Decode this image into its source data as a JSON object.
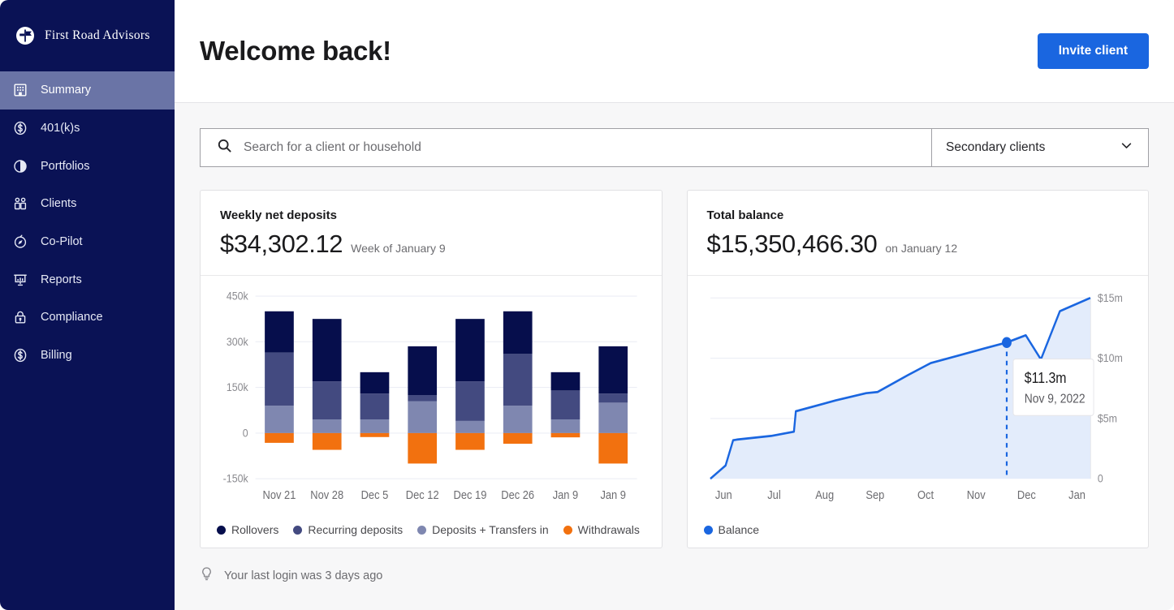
{
  "brand": {
    "name": "First Road Advisors",
    "logo_icon": "road-marker-circle-icon",
    "sidebar_bg": "#0a1255",
    "active_bg": "#6a74a6"
  },
  "sidebar": {
    "items": [
      {
        "label": "Summary",
        "icon": "building-icon",
        "active": true
      },
      {
        "label": "401(k)s",
        "icon": "dollar-circle-icon",
        "active": false
      },
      {
        "label": "Portfolios",
        "icon": "pie-chart-icon",
        "active": false
      },
      {
        "label": "Clients",
        "icon": "people-icon",
        "active": false
      },
      {
        "label": "Co-Pilot",
        "icon": "compass-icon",
        "active": false
      },
      {
        "label": "Reports",
        "icon": "presentation-chart-icon",
        "active": false
      },
      {
        "label": "Compliance",
        "icon": "lock-icon",
        "active": false
      },
      {
        "label": "Billing",
        "icon": "dollar-circle-icon",
        "active": false
      }
    ]
  },
  "header": {
    "title": "Welcome back!",
    "invite_button": "Invite client",
    "accent": "#1a66e0"
  },
  "search": {
    "placeholder": "Search for a client or household",
    "value": "",
    "icon": "search-icon"
  },
  "filter": {
    "selected": "Secondary clients",
    "icon": "chevron-down-icon"
  },
  "cards": {
    "deposits": {
      "title": "Weekly net deposits",
      "value": "$34,302.12",
      "subtitle": "Week of January 9"
    },
    "balance": {
      "title": "Total balance",
      "value": "$15,350,466.30",
      "subtitle": "on January 12"
    }
  },
  "footer": {
    "icon": "lightbulb-icon",
    "text": "Your last login was 3 days ago"
  },
  "chart_data": [
    {
      "id": "weekly-net-deposits",
      "type": "bar",
      "title": "Weekly net deposits",
      "stacked": true,
      "xlabel": "",
      "ylabel": "",
      "ylim": [
        -150000,
        450000
      ],
      "yticks": [
        450000,
        300000,
        150000,
        0,
        -150000
      ],
      "ytick_labels": [
        "450k",
        "300k",
        "150k",
        "0",
        "-150k"
      ],
      "grid": true,
      "legend_position": "bottom",
      "categories": [
        "Nov 21",
        "Nov 28",
        "Dec 5",
        "Dec 12",
        "Dec 19",
        "Dec 26",
        "Jan 9",
        "Jan 9"
      ],
      "series": [
        {
          "name": "Deposits + Transfers in",
          "color": "#7f87b0",
          "values": [
            90000,
            45000,
            45000,
            105000,
            40000,
            90000,
            45000,
            100000
          ]
        },
        {
          "name": "Recurring deposits",
          "color": "#434a80",
          "values": [
            175000,
            125000,
            85000,
            20000,
            130000,
            170000,
            95000,
            30000
          ]
        },
        {
          "name": "Rollovers",
          "color": "#060e4c",
          "values": [
            135000,
            205000,
            70000,
            160000,
            205000,
            140000,
            60000,
            155000
          ]
        },
        {
          "name": "Withdrawals",
          "color": "#f2710f",
          "values": [
            -32000,
            -55000,
            -13000,
            -100000,
            -55000,
            -35000,
            -14000,
            -100000
          ]
        }
      ]
    },
    {
      "id": "total-balance",
      "type": "area",
      "title": "Total balance",
      "line_color": "#1a66e0",
      "fill_color": "#e3ecfb",
      "xlabel": "",
      "ylabel": "",
      "ylim": [
        0,
        15000000
      ],
      "yticks": [
        15000000,
        10000000,
        5000000,
        0
      ],
      "ytick_labels": [
        "$15m",
        "$10m",
        "$5m",
        "0"
      ],
      "grid": true,
      "legend_position": "bottom",
      "legend": [
        "Balance"
      ],
      "xticks": [
        "Jun",
        "Jul",
        "Aug",
        "Sep",
        "Oct",
        "Nov",
        "Dec",
        "Jan"
      ],
      "x": [
        0.0,
        0.04,
        0.06,
        0.07,
        0.16,
        0.22,
        0.225,
        0.33,
        0.41,
        0.44,
        0.52,
        0.58,
        0.65,
        0.72,
        0.78,
        0.83,
        0.87,
        0.92,
        1.0
      ],
      "values": [
        0.0,
        1.1,
        3.2,
        3.25,
        3.55,
        3.9,
        5.6,
        6.5,
        7.1,
        7.2,
        8.6,
        9.6,
        10.2,
        10.8,
        11.3,
        11.9,
        9.9,
        13.9,
        15.0
      ],
      "value_unit": "millions USD",
      "annotation": {
        "value": "$11.3m",
        "date": "Nov 9, 2022",
        "marker_x": 0.78,
        "marker_y": 11.3
      }
    }
  ]
}
